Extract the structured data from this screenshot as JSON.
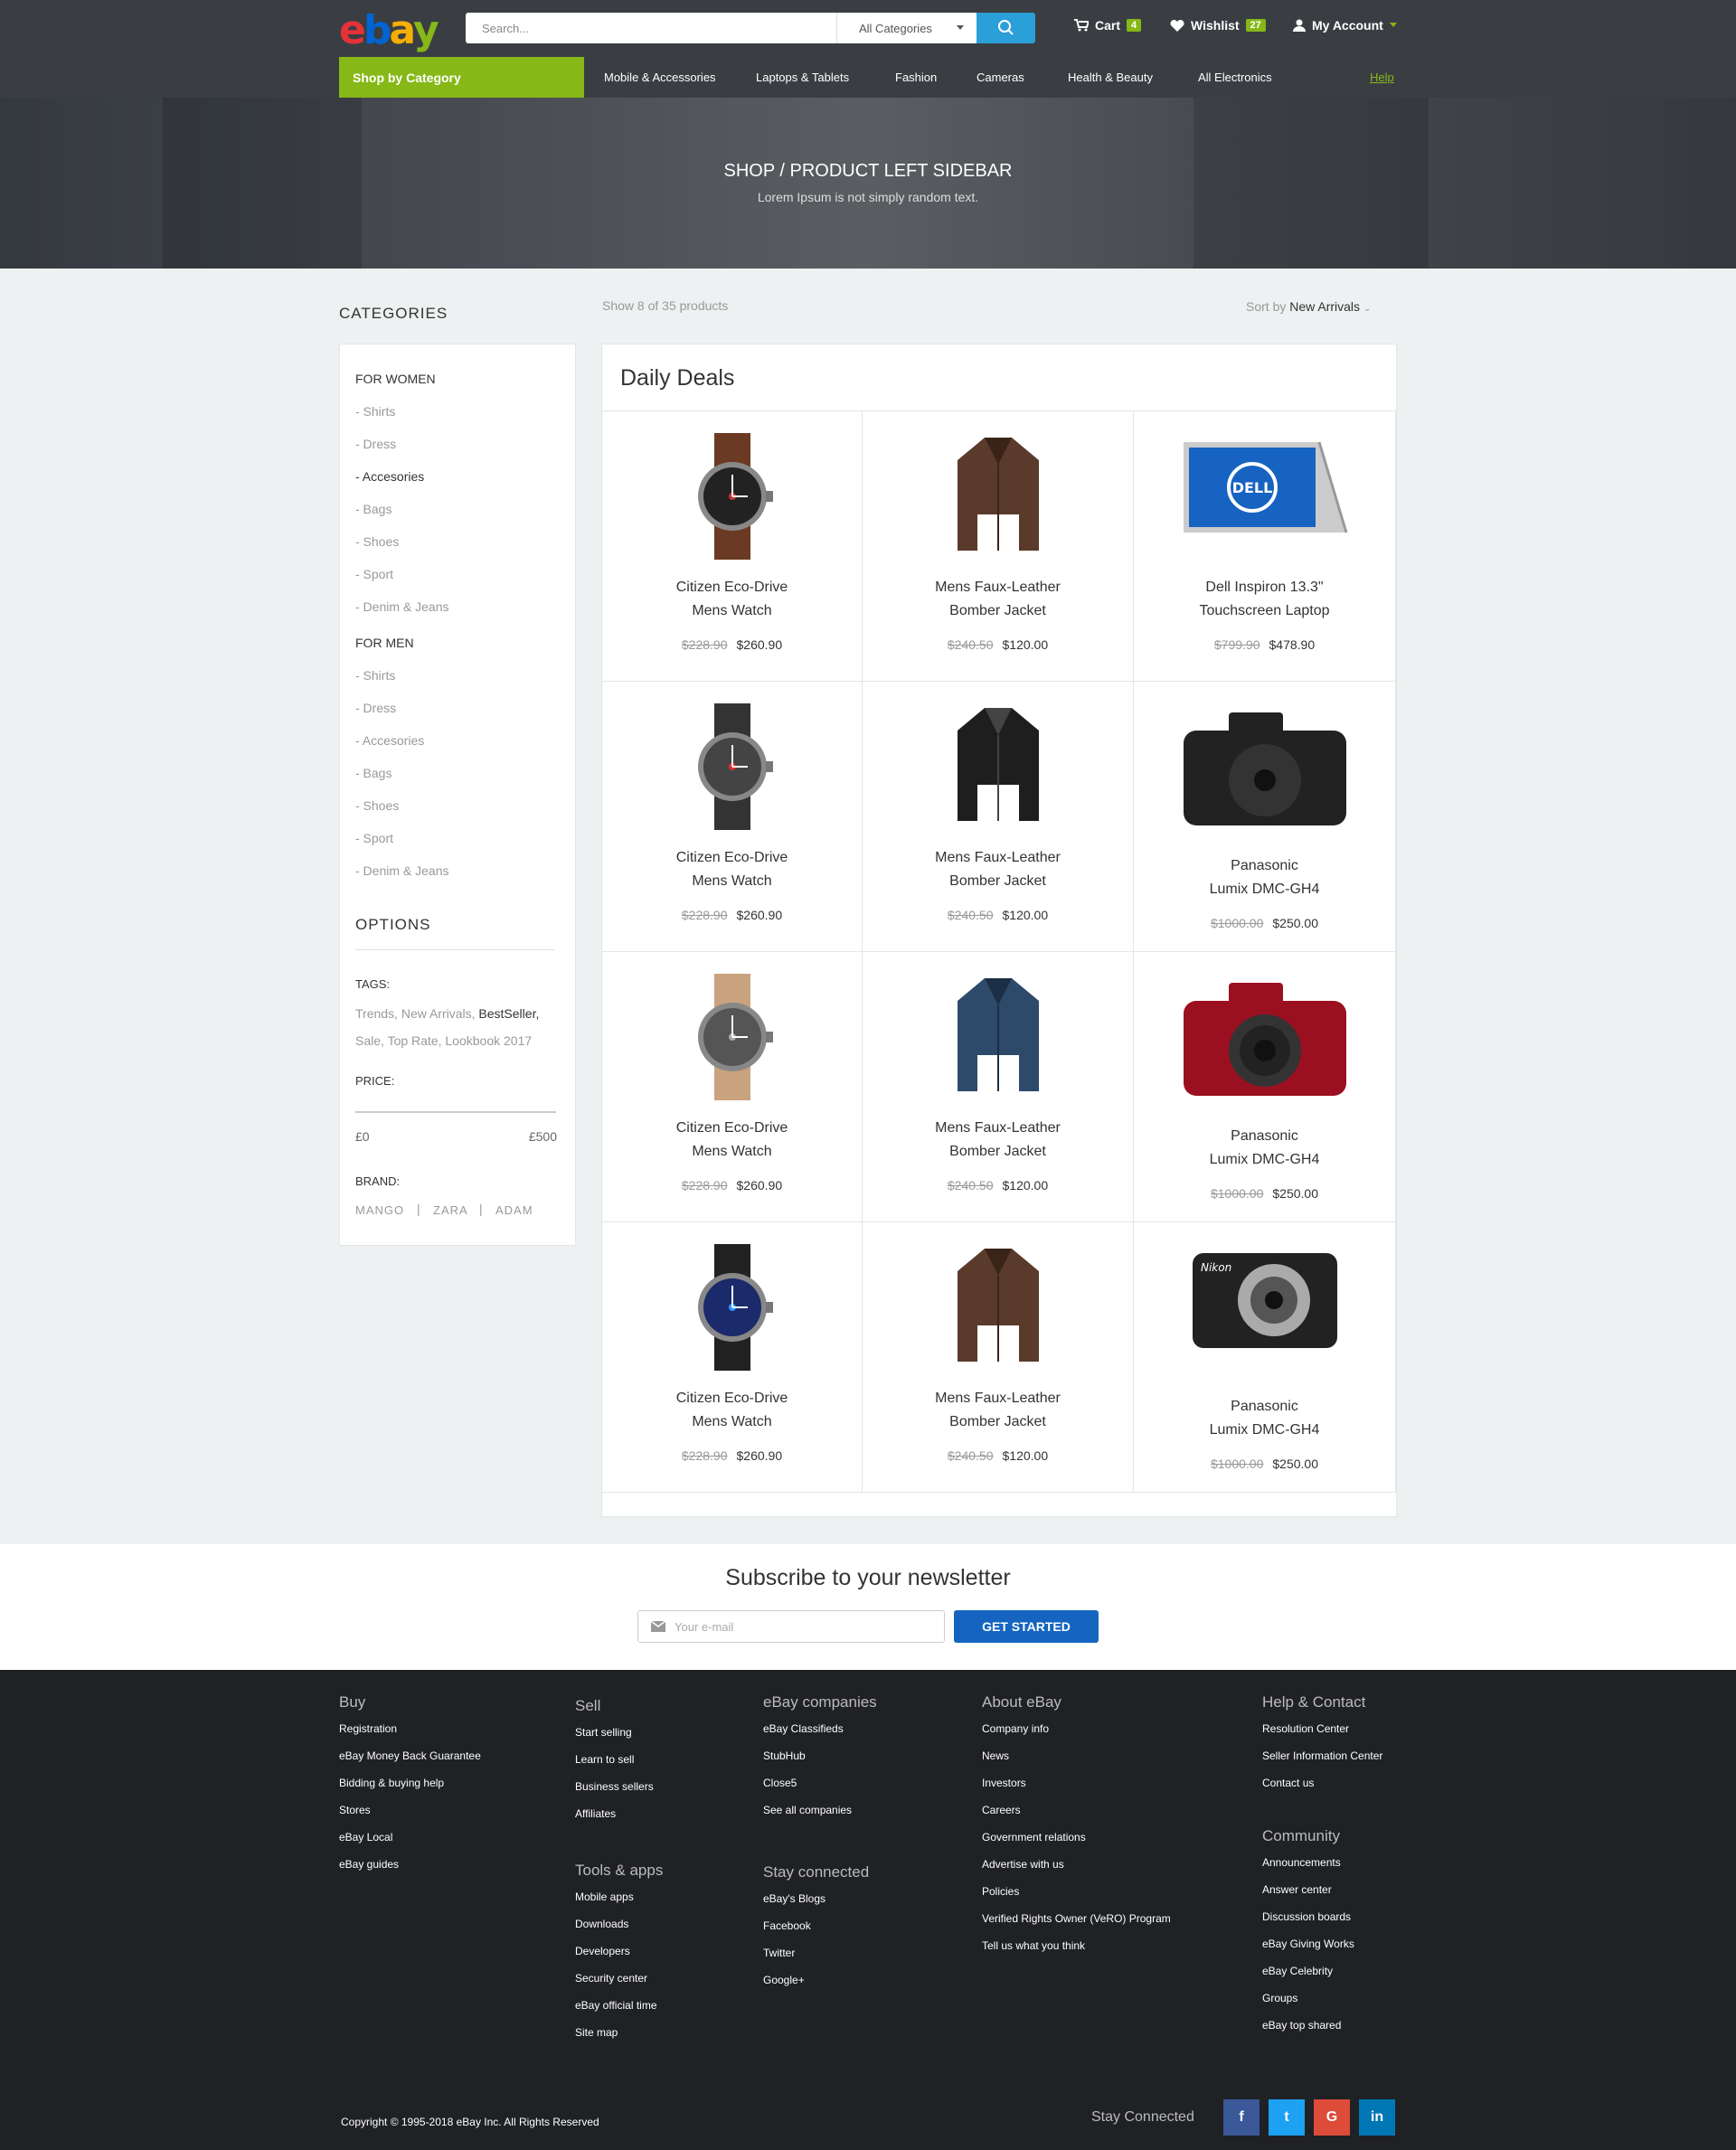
{
  "brand": {
    "logo_letters": [
      "e",
      "b",
      "a",
      "y"
    ],
    "logo_colors": [
      "#e53238",
      "#0064d2",
      "#f5af02",
      "#86b817"
    ]
  },
  "header": {
    "search_placeholder": "Search...",
    "category_select": "All Categories",
    "cart_label": "Cart",
    "cart_count": "4",
    "wishlist_label": "Wishlist",
    "wishlist_count": "27",
    "account_label": "My Account"
  },
  "nav": {
    "shop_by_category": "Shop by Category",
    "items": [
      "Mobile & Accessories",
      "Laptops & Tablets",
      "Fashion",
      "Cameras",
      "Health & Beauty",
      "All Electronics"
    ],
    "help": "Help"
  },
  "hero": {
    "title": "SHOP / PRODUCT LEFT SIDEBAR",
    "subtitle": "Lorem Ipsum is not simply random text."
  },
  "sidebar": {
    "categories_title": "CATEGORIES",
    "women_title": "FOR WOMEN",
    "women_items": [
      "- Shirts",
      "- Dress",
      "- Accesories",
      "- Bags",
      "- Shoes",
      "- Sport",
      "- Denim & Jeans"
    ],
    "men_title": "FOR MEN",
    "men_items": [
      "- Shirts",
      "- Dress",
      "- Accesories",
      "- Bags",
      "- Shoes",
      "- Sport",
      "- Denim & Jeans"
    ],
    "options_title": "OPTIONS",
    "tags_label": "TAGS:",
    "tags": [
      "Trends,",
      "New Arrivals,",
      "BestSeller,",
      "Sale,",
      "Top Rate,",
      "Lookbook 2017"
    ],
    "price_label": "PRICE:",
    "price_min": "£0",
    "price_max": "£500",
    "brand_label": "BRAND:",
    "brands": [
      "MANGO",
      "ZARA",
      "ADAM"
    ],
    "brand_sep": "|"
  },
  "toolbar": {
    "showing": "Show 8 of 35 products",
    "sort_prefix": "Sort by",
    "sort_value": "New Arrivals"
  },
  "deals": {
    "title": "Daily Deals",
    "products": [
      {
        "line1": "Citizen Eco-Drive",
        "line2": "Mens Watch",
        "old": "$228.90",
        "price": "$260.90",
        "icon": "watch-brown-icon"
      },
      {
        "line1": "Mens Faux-Leather",
        "line2": "Bomber Jacket",
        "old": "$240.50",
        "price": "$120.00",
        "icon": "jacket-brown-icon"
      },
      {
        "line1": "Dell Inspiron 13.3\"",
        "line2": "Touchscreen Laptop",
        "old": "$799.90",
        "price": "$478.90",
        "icon": "laptop-dell-icon"
      },
      {
        "line1": "Citizen Eco-Drive",
        "line2": "Mens Watch",
        "old": "$228.90",
        "price": "$260.90",
        "icon": "watch-red-icon"
      },
      {
        "line1": "Mens Faux-Leather",
        "line2": "Bomber Jacket",
        "old": "$240.50",
        "price": "$120.00",
        "icon": "jacket-black-icon"
      },
      {
        "line1": "Panasonic",
        "line2": "Lumix DMC-GH4",
        "old": "$1000.00",
        "price": "$250.00",
        "icon": "camera-lumix-icon"
      },
      {
        "line1": "Citizen Eco-Drive",
        "line2": "Mens Watch",
        "old": "$228.90",
        "price": "$260.90",
        "icon": "watch-tan-icon"
      },
      {
        "line1": "Mens Faux-Leather",
        "line2": "Bomber Jacket",
        "old": "$240.50",
        "price": "$120.00",
        "icon": "jacket-denim-icon"
      },
      {
        "line1": "Panasonic",
        "line2": "Lumix DMC-GH4",
        "old": "$1000.00",
        "price": "$250.00",
        "icon": "camera-red-icon"
      },
      {
        "line1": "Citizen Eco-Drive",
        "line2": "Mens Watch",
        "old": "$228.90",
        "price": "$260.90",
        "icon": "watch-blue-icon"
      },
      {
        "line1": "Mens Faux-Leather",
        "line2": "Bomber Jacket",
        "old": "$240.50",
        "price": "$120.00",
        "icon": "jacket-brown-icon"
      },
      {
        "line1": "Panasonic",
        "line2": "Lumix DMC-GH4",
        "old": "$1000.00",
        "price": "$250.00",
        "icon": "camera-nikon-icon"
      }
    ]
  },
  "newsletter": {
    "title": "Subscribe to your newsletter",
    "placeholder": "Your e-mail",
    "button": "GET STARTED"
  },
  "footer": {
    "buy": {
      "title": "Buy",
      "links": [
        "Registration",
        "eBay Money Back Guarantee",
        "Bidding & buying help",
        "Stores",
        "eBay Local",
        "eBay guides"
      ]
    },
    "sell": {
      "title": "Sell",
      "links": [
        "Start selling",
        "Learn to sell",
        "Business sellers",
        "Affiliates"
      ]
    },
    "tools": {
      "title": "Tools & apps",
      "links": [
        "Mobile apps",
        "Downloads",
        "Developers",
        "Security center",
        "eBay official time",
        "Site map"
      ]
    },
    "companies": {
      "title": "eBay companies",
      "links": [
        "eBay Classifieds",
        "StubHub",
        "Close5",
        "See all companies"
      ]
    },
    "stay": {
      "title": "Stay connected",
      "links": [
        "eBay's Blogs",
        "Facebook",
        "Twitter",
        "Google+"
      ]
    },
    "about": {
      "title": "About eBay",
      "links": [
        "Company info",
        "News",
        "Investors",
        "Careers",
        "Government relations",
        "Advertise with us",
        "Policies",
        "Verified Rights Owner (VeRO) Program",
        "Tell us what you think"
      ]
    },
    "help": {
      "title": "Help & Contact",
      "links": [
        "Resolution Center",
        "Seller Information Center",
        "Contact us"
      ]
    },
    "community": {
      "title": "Community",
      "links": [
        "Announcements",
        "Answer center",
        "Discussion boards",
        "eBay Giving Works",
        "eBay Celebrity",
        "Groups",
        "eBay top shared"
      ]
    },
    "copyright": "Copyright © 1995-2018 eBay Inc. All Rights Reserved",
    "stay_connected": "Stay Connected",
    "social": [
      {
        "label": "f",
        "color": "#3b5998"
      },
      {
        "label": "t",
        "color": "#1da1f2"
      },
      {
        "label": "G",
        "color": "#dd4b39"
      },
      {
        "label": "in",
        "color": "#0077b5"
      }
    ]
  }
}
